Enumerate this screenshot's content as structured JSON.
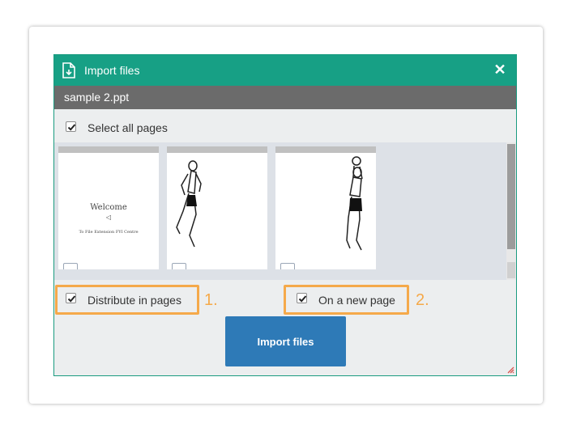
{
  "dialog": {
    "title": "Import files",
    "close_icon": "close-icon",
    "file_name": "sample 2.ppt",
    "select_all_label": "Select all pages",
    "select_all_checked": true
  },
  "thumbnails": [
    {
      "name": "slide-1",
      "title_text": "Welcome",
      "subtitle_text": "To File Extension FYI Centre"
    },
    {
      "name": "slide-2"
    },
    {
      "name": "slide-3"
    }
  ],
  "options": {
    "distribute_label": "Distribute in pages",
    "distribute_checked": true,
    "distribute_callout": "1.",
    "new_page_label": "On a new page",
    "new_page_checked": true,
    "new_page_callout": "2."
  },
  "import_button_label": "Import files",
  "colors": {
    "titlebar": "#17a085",
    "filebar": "#6b6b6b",
    "button": "#2e7ab7",
    "highlight": "#f5a94a"
  }
}
